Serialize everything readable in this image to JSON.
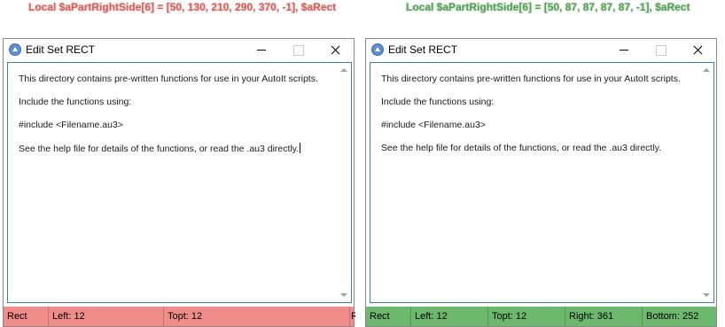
{
  "captions": {
    "left": "Local $aPartRightSide[6] = [50, 130, 210, 290, 370, -1], $aRect",
    "right": "Local $aPartRightSide[6] = [50, 87, 87, 87, 87, -1], $aRect"
  },
  "windows": [
    {
      "title": "Edit Set RECT",
      "editor_lines": [
        "This directory contains pre-written functions for use in your AutoIt scripts.",
        "Include the functions using:",
        "#include <Filename.au3>",
        "See the help file for details of the functions, or read the .au3 directly."
      ],
      "status_parts": [
        "Rect",
        "Left: 12",
        "Topt: 12",
        "R"
      ],
      "status_color": "#f08c8a"
    },
    {
      "title": "Edit Set RECT",
      "editor_lines": [
        "This directory contains pre-written functions for use in your AutoIt scripts.",
        "Include the functions using:",
        "#include <Filename.au3>",
        "See the help file for details of the functions, or read the .au3 directly."
      ],
      "status_parts": [
        "Rect",
        "Left: 12",
        "Topt: 12",
        "Right: 361",
        "Bottom: 252"
      ],
      "status_color": "#6cb86c"
    }
  ],
  "colors": {
    "left_caption": "#e05b55",
    "right_caption": "#4aa64a",
    "editor_border": "#3c7fb1"
  }
}
